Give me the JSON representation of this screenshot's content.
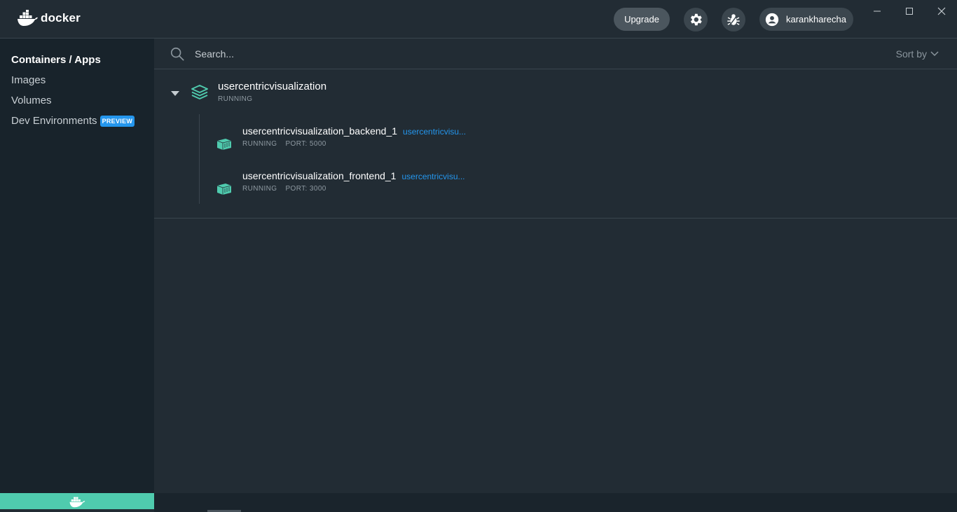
{
  "header": {
    "brand": "docker",
    "upgrade_label": "Upgrade",
    "account_name": "karankharecha"
  },
  "sidebar": {
    "items": [
      {
        "label": "Containers / Apps"
      },
      {
        "label": "Images"
      },
      {
        "label": "Volumes"
      },
      {
        "label": "Dev Environments",
        "badge": "PREVIEW"
      }
    ]
  },
  "search": {
    "placeholder": "Search...",
    "sort_label": "Sort by"
  },
  "apps": [
    {
      "name": "usercentricvisualization",
      "status": "RUNNING",
      "containers": [
        {
          "name": "usercentricvisualization_backend_1",
          "link": "usercentricvisu...",
          "status": "RUNNING",
          "port": "PORT: 5000"
        },
        {
          "name": "usercentricvisualization_frontend_1",
          "link": "usercentricvisu...",
          "status": "RUNNING",
          "port": "PORT: 3000"
        }
      ]
    }
  ],
  "colors": {
    "accent_teal": "#4fcbae",
    "link_blue": "#2496ed",
    "background": "#222c34",
    "sidebar": "#18232b"
  }
}
